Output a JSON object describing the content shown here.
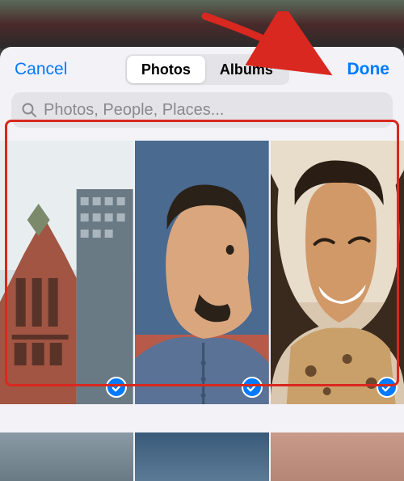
{
  "nav": {
    "cancel_label": "Cancel",
    "done_label": "Done"
  },
  "segmented": {
    "photos_label": "Photos",
    "albums_label": "Albums",
    "active": "photos"
  },
  "search": {
    "placeholder": "Photos, People, Places..."
  },
  "colors": {
    "accent": "#007aff",
    "highlight": "#d9281f"
  },
  "photos": [
    {
      "id": "photo-building",
      "selected": true
    },
    {
      "id": "photo-man",
      "selected": true
    },
    {
      "id": "photo-woman",
      "selected": true
    }
  ]
}
